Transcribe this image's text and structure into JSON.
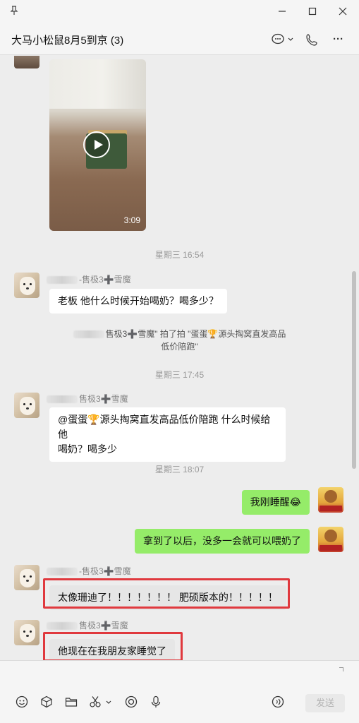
{
  "window": {
    "pin_icon": "pin-icon",
    "minimize": "—",
    "maximize": "☐",
    "close": "✕"
  },
  "header": {
    "title": "大马小松鼠8月5到京 (3)",
    "chat_icon": "💬⌄",
    "call_icon": "📞",
    "more_icon": "···"
  },
  "messages": {
    "video_duration": "3:09",
    "ts1": "星期三 16:54",
    "msg1_sender_suffix": "-售极3",
    "msg1_sender_tail": "雪魔",
    "msg1_text": "老板 他什么时候开始喝奶？喝多少？",
    "system_line1": "售极3➕雪魔\" 拍了拍 \"蛋蛋🏆源头掏窝直发高品",
    "system_line2": "低价陪跑\"",
    "ts2": "星期三 17:45",
    "msg2_sender_suffix": "售极3",
    "msg2_sender_tail": "雪魔",
    "msg2_line1": "@蛋蛋🏆源头掏窝直发高品低价陪跑 什么时候给他",
    "msg2_line2": "喝奶？喝多少",
    "ts3": "星期三 18:07",
    "mine1_text": "我刚睡醒😂",
    "mine2_text": "拿到了以后，没多一会就可以喂奶了",
    "msg3_sender_suffix": "-售极3",
    "msg3_sender_tail": "雪魔",
    "msg3_text": "太像珊迪了！！！！！！！ 肥硕版本的！！！！！",
    "msg4_sender_suffix": "售极3",
    "msg4_sender_tail": "雪魔",
    "msg4_text": "他现在在我朋友家睡觉了",
    "cross_glyph": "➕"
  },
  "toolbar": {
    "emoji": "☺",
    "favorites": "⬡",
    "folder": "🗀",
    "screenshot": "✂⌄",
    "record": "◎",
    "voice": "🎙",
    "voice_input": "◉",
    "send_label": "发送"
  }
}
